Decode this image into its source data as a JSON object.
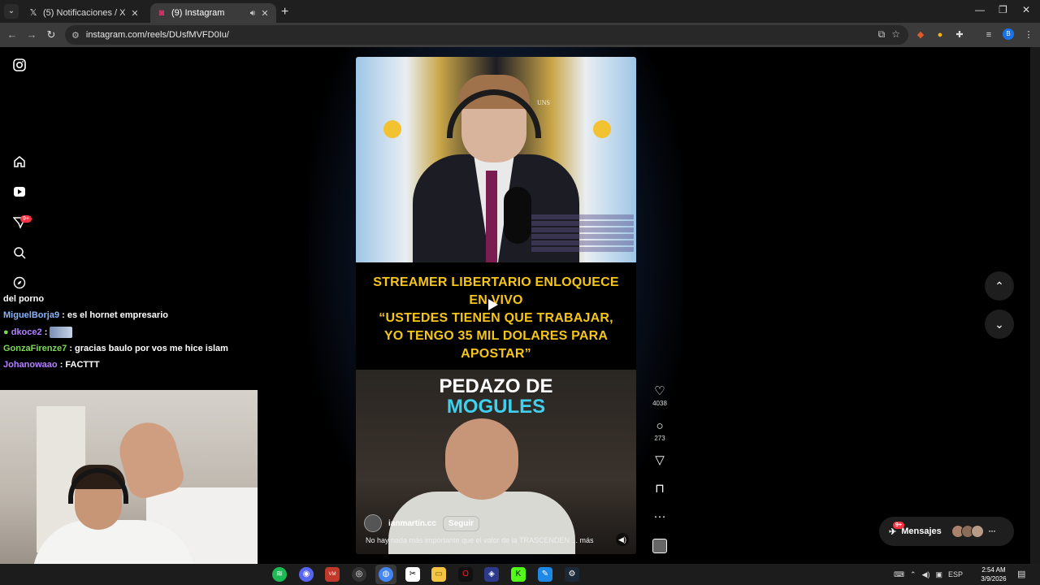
{
  "browser": {
    "tabs": [
      {
        "title": "(5) Notificaciones / X",
        "favicon": "x-logo-icon",
        "active": false
      },
      {
        "title": "(9) Instagram",
        "favicon": "instagram-icon",
        "active": true
      }
    ],
    "new_tab_icon": "+",
    "url": "instagram.com/reels/DUsfMVFD0Iu/",
    "profile_initial": "B"
  },
  "instagram": {
    "sidebar": {
      "logo_icon": "instagram-logo-icon",
      "items": [
        {
          "name": "home-icon",
          "glyph": "⌂"
        },
        {
          "name": "reels-icon",
          "glyph": "▶"
        },
        {
          "name": "messages-icon",
          "glyph": "✈"
        },
        {
          "name": "search-icon",
          "glyph": "⌕"
        },
        {
          "name": "explore-icon",
          "glyph": "◎"
        }
      ],
      "notification_badge": "9+"
    },
    "reel": {
      "flag_label": "UNS",
      "headline": "STREAMER LIBERTARIO ENLOQUECE EN VIVO\n“USTEDES TIENEN QUE TRABAJAR, YO TENGO 35 MIL DOLARES PARA APOSTAR”",
      "headline_lines": [
        "STREAMER LIBERTARIO ENLOQUECE",
        "EN VIVO",
        "“USTEDES TIENEN QUE TRABAJAR,",
        "YO TENGO 35 MIL DOLARES PARA",
        "APOSTAR”"
      ],
      "pedazo_line1": "PEDAZO DE",
      "pedazo_line2": "MOGULES",
      "author": "ianmartin.cc",
      "follow_label": "Seguir",
      "caption": "No hay nada más importante que el valor de la TRASCENDEN ... más"
    },
    "actions": {
      "likes": "4038",
      "comments": "273"
    },
    "messages": {
      "label": "Mensajes",
      "badge": "9+"
    }
  },
  "stream_chat": [
    {
      "user": "",
      "text": "del porno"
    },
    {
      "user": "MiguelBorja9",
      "text": ": es el hornet empresario"
    },
    {
      "user": "dkoce2",
      "text": ":"
    },
    {
      "user": "GonzaFirenze7",
      "text": ": gracias baulo por vos me hice islam"
    },
    {
      "user": "Johanowaao",
      "text": ": FACTTT"
    }
  ],
  "taskbar": {
    "tray_language": "ESP",
    "time": "2:54 AM",
    "date": "3/9/2026"
  }
}
